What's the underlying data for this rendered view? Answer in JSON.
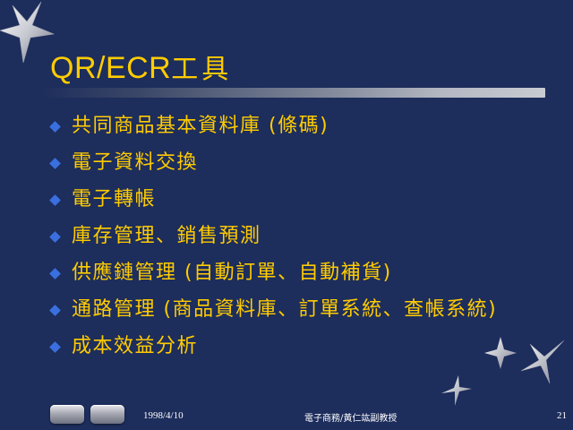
{
  "slide": {
    "title_latin": "QR/ECR",
    "title_cjk": "工具",
    "bullets": [
      "共同商品基本資料庫 (條碼)",
      "電子資料交換",
      "電子轉帳",
      "庫存管理、銷售預測",
      "供應鏈管理 (自動訂單、自動補貨)",
      "通路管理 (商品資料庫、訂單系統、查帳系統)",
      "成本效益分析"
    ]
  },
  "footer": {
    "date": "1998/4/10",
    "course": "電子商務/黃仁竑副教授",
    "page": "21"
  },
  "colors": {
    "background": "#1d2d5c",
    "text": "#ffcc00",
    "bullet": "#3a6fe0"
  },
  "icons": [
    "star-icon",
    "diamond-bullet-icon",
    "previous-slide-button",
    "next-slide-button"
  ]
}
